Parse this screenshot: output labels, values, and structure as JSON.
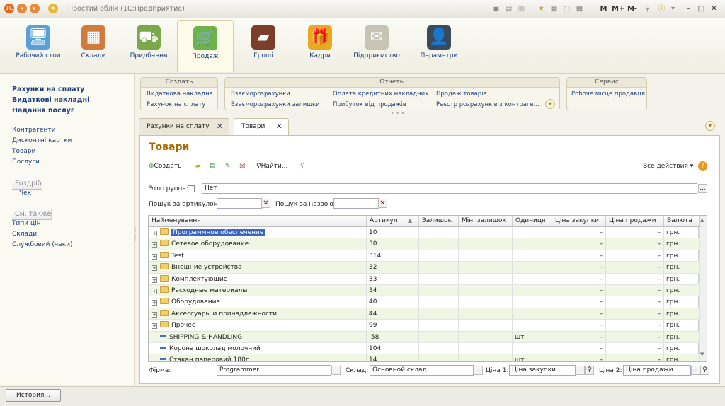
{
  "app": {
    "title": "Простий облік  (1С:Предприятие)"
  },
  "titlebar_icons": {
    "m": "M",
    "mplus": "M+",
    "mminus": "M-"
  },
  "sections": [
    {
      "label": "Рабочий стол",
      "icon": "desktop-icon",
      "color": "#5aa0d8"
    },
    {
      "label": "Склади",
      "icon": "warehouse-icon",
      "color": "#d07c3a"
    },
    {
      "label": "Придбання",
      "icon": "truck-icon",
      "color": "#7aa84a"
    },
    {
      "label": "Продаж",
      "icon": "cart-icon",
      "color": "#6bb34a"
    },
    {
      "label": "Гроші",
      "icon": "wallet-icon",
      "color": "#7a3e2a"
    },
    {
      "label": "Кадри",
      "icon": "gift-icon",
      "color": "#e8a920"
    },
    {
      "label": "Підприємство",
      "icon": "envelope-icon",
      "color": "#c8c4b4"
    },
    {
      "label": "Параметри",
      "icon": "user-settings-icon",
      "color": "#3a4a5a"
    }
  ],
  "left_nav": {
    "bold_items": [
      "Рахунки на сплату",
      "Видаткові накладні",
      "Надання послуг"
    ],
    "items": [
      "Контрагенти",
      "Дисконтні картки",
      "Товари",
      "Послуги"
    ],
    "group_retail": "Роздріб",
    "retail_items": [
      "Чек"
    ],
    "see_also": "См. также",
    "see_also_items": [
      "Типи цін",
      "Склади",
      "Службовий (чеки)"
    ]
  },
  "command_groups": {
    "create": {
      "title": "Создать",
      "items": [
        "Видаткова накладна",
        "Рахунок на сплату"
      ]
    },
    "reports": {
      "title": "Отчеты",
      "col1": [
        "Взаєморозрахунки",
        "Взаєморозрахунки залишки"
      ],
      "col2": [
        "Оплата кредитних накладних",
        "Прибуток від продажів"
      ],
      "col3": [
        "Продаж товарів",
        "Реєстр розрахунків з контраге..."
      ]
    },
    "service": {
      "title": "Сервис",
      "items": [
        "Робоче місце продавця"
      ]
    }
  },
  "tabs": [
    {
      "label": "Рахунки на сплату"
    },
    {
      "label": "Товари"
    }
  ],
  "form": {
    "title": "Товари",
    "toolbar": {
      "create": "Создать",
      "find": "Найти...",
      "all_actions": "Все действия"
    },
    "is_group_label": "Это группа:",
    "is_group_value": "Нет",
    "search_article_label": "Пошук за артикулом:",
    "search_name_label": "Пошук за назвою:",
    "search_article_value": "",
    "search_name_value": ""
  },
  "table": {
    "columns": [
      "Найменування",
      "Артикул",
      "Залишок",
      "Мін. залишок",
      "Одиниця",
      "Ціна закупки",
      "Ціна продажи",
      "Валюта"
    ],
    "rows": [
      {
        "type": "group",
        "name": "Программное обеспечение",
        "article": "10",
        "stock": "",
        "min": "",
        "unit": "",
        "buy": "-",
        "sell": "-",
        "cur": "грн."
      },
      {
        "type": "group",
        "name": "Сетевое оборудование",
        "article": "30",
        "stock": "",
        "min": "",
        "unit": "",
        "buy": "-",
        "sell": "-",
        "cur": "грн."
      },
      {
        "type": "group",
        "name": "Test",
        "article": "314",
        "stock": "",
        "min": "",
        "unit": "",
        "buy": "-",
        "sell": "-",
        "cur": "грн."
      },
      {
        "type": "group",
        "name": "Внешние устройства",
        "article": "32",
        "stock": "",
        "min": "",
        "unit": "",
        "buy": "-",
        "sell": "-",
        "cur": "грн."
      },
      {
        "type": "group",
        "name": "Комплектующие",
        "article": "33",
        "stock": "",
        "min": "",
        "unit": "",
        "buy": "-",
        "sell": "-",
        "cur": "грн."
      },
      {
        "type": "group",
        "name": "Расходные материалы",
        "article": "34",
        "stock": "",
        "min": "",
        "unit": "",
        "buy": "-",
        "sell": "-",
        "cur": "грн."
      },
      {
        "type": "group",
        "name": "Оборудование",
        "article": "40",
        "stock": "",
        "min": "",
        "unit": "",
        "buy": "-",
        "sell": "-",
        "cur": "грн."
      },
      {
        "type": "group",
        "name": "Аксессуары и принадлежности",
        "article": "44",
        "stock": "",
        "min": "",
        "unit": "",
        "buy": "-",
        "sell": "-",
        "cur": "грн."
      },
      {
        "type": "group",
        "name": "Прочее",
        "article": "99",
        "stock": "",
        "min": "",
        "unit": "",
        "buy": "-",
        "sell": "-",
        "cur": "грн."
      },
      {
        "type": "item",
        "name": "SHIPPING & HANDLING",
        "article": ".58",
        "stock": "",
        "min": "",
        "unit": "шт",
        "buy": "-",
        "sell": "-",
        "cur": "грн."
      },
      {
        "type": "item",
        "name": "Корона шоколад молочний",
        "article": "104",
        "stock": "",
        "min": "",
        "unit": "",
        "buy": "-",
        "sell": "-",
        "cur": "грн."
      },
      {
        "type": "item",
        "name": "Стакан паперовий 180г",
        "article": "14",
        "stock": "",
        "min": "",
        "unit": "шт",
        "buy": "-",
        "sell": "-",
        "cur": "грн."
      }
    ]
  },
  "footer": {
    "firm_label": "Фірма:",
    "firm_value": "Programmer",
    "warehouse_label": "Склад:",
    "warehouse_value": "Основной склад",
    "price1_label": "Ціна 1:",
    "price1_value": "Ціна закупки",
    "price2_label": "Ціна 2:",
    "price2_value": "Ціна продажи"
  },
  "history_button": "История...",
  "colors": {
    "accent_title": "#a46a00",
    "link": "#1c3e7c",
    "selection": "#3b66c4",
    "row_alt": "#f0f6e4"
  }
}
